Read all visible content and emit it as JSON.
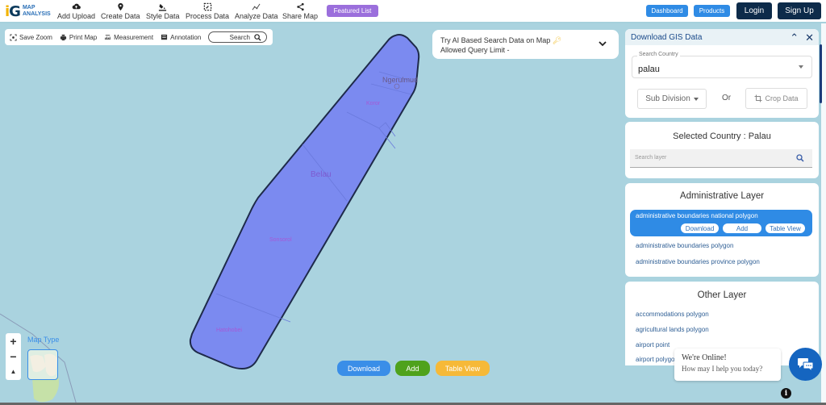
{
  "brand": {
    "mark": "iG",
    "line1": "MAP",
    "line2": "ANALYSIS"
  },
  "nav": [
    {
      "label": "Add Upload",
      "icon": "cloud-upload-icon"
    },
    {
      "label": "Create Data",
      "icon": "map-pin-icon"
    },
    {
      "label": "Style Data",
      "icon": "paint-bucket-icon"
    },
    {
      "label": "Process Data",
      "icon": "process-icon"
    },
    {
      "label": "Analyze Data",
      "icon": "analyze-icon"
    },
    {
      "label": "Share Map",
      "icon": "share-icon"
    }
  ],
  "header_buttons": {
    "featured": "Featured List",
    "dashboard": "Dashboard",
    "products": "Products",
    "login": "Login",
    "signup": "Sign Up"
  },
  "toolbar": {
    "save_zoom": "Save Zoom",
    "print_map": "Print Map",
    "measurement": "Measurement",
    "annotation": "Annotation",
    "search": "Search"
  },
  "ai_search": {
    "line1": "Try AI Based Search Data on Map",
    "line2": "Allowed Query Limit -",
    "icon": "key-icon"
  },
  "map": {
    "labels": {
      "capital": "Ngerulmud",
      "koror": "Koror",
      "country": "Belau",
      "sonsorol": "Sonsorol",
      "hatohobei": "Hatohobei"
    },
    "polygon_fill": "#7b8af0",
    "polygon_stroke": "#1e2a4a",
    "water_color": "#aad3df",
    "map_type_label": "Map Type",
    "zoom_in": "+",
    "zoom_out": "−",
    "reset": "▲"
  },
  "map_buttons": {
    "download": "Download",
    "add": "Add",
    "table_view": "Table View",
    "colors": {
      "download": "#3a8ee8",
      "add": "#4fa21c",
      "table_view": "#f6b938"
    }
  },
  "gis_panel": {
    "title": "Download GIS Data",
    "country_label": "Search Country",
    "country_value": "palau",
    "subdivision": "Sub Division",
    "or": "Or",
    "crop": "Crop Data"
  },
  "selected": {
    "title": "Selected Country : Palau",
    "search_placeholder": "Search layer"
  },
  "admin_layer": {
    "title": "Administrative Layer",
    "selected": {
      "label": "administrative boundaries national polygon",
      "download": "Download",
      "add": "Add",
      "table_view": "Table View"
    },
    "items": [
      "administrative boundaries polygon",
      "administrative boundaries province polygon"
    ]
  },
  "other_layer": {
    "title": "Other Layer",
    "items": [
      "accommodations polygon",
      "agricultural lands polygon",
      "airport point",
      "airport polygon"
    ]
  },
  "chat": {
    "title": "We're Online!",
    "subtitle": "How may I help you today?"
  },
  "info": "i"
}
